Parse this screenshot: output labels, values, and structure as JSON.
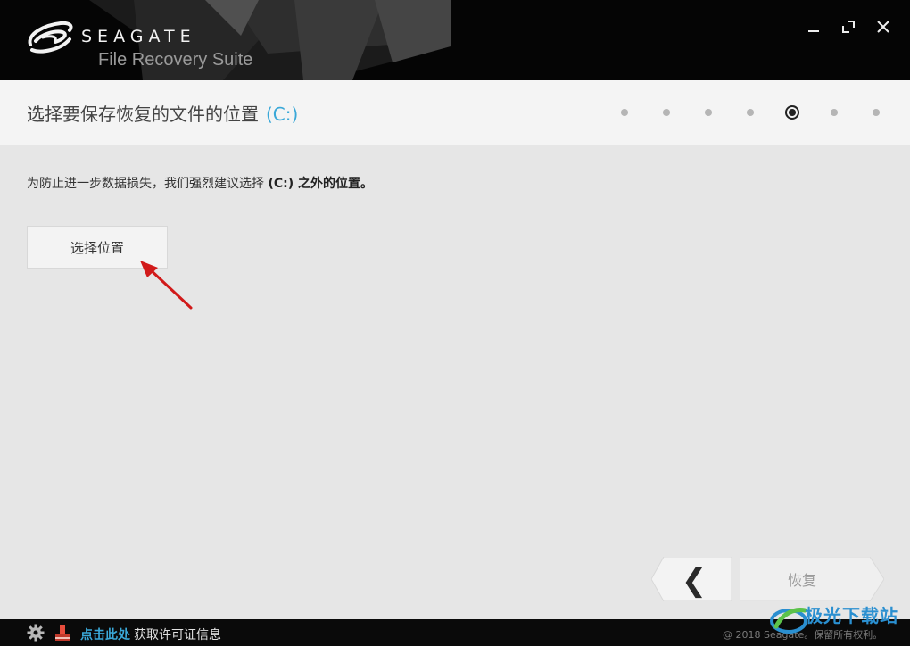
{
  "header": {
    "brand": "SEAGATE",
    "product": "File Recovery Suite"
  },
  "step": {
    "title": "选择要保存恢复的文件的位置",
    "drive": "(C:)",
    "total_steps": 7,
    "current_step": 5
  },
  "content": {
    "notice_prefix": "为防止进一步数据损失，我们强烈建议选择 ",
    "notice_drive": "(C:)",
    "notice_suffix": " 之外的位置。",
    "choose_button": "选择位置"
  },
  "nav": {
    "back_glyph": "❮",
    "next_label": "恢复"
  },
  "footer": {
    "link_text": "点击此处",
    "text": "获取许可证信息",
    "copyright": "@ 2018 Seagate。保留所有权利。"
  },
  "watermark": {
    "text": "极光下载站"
  },
  "colors": {
    "accent": "#3aa8d8",
    "header_bg": "#050505",
    "annotation_arrow": "#d11a1a"
  }
}
